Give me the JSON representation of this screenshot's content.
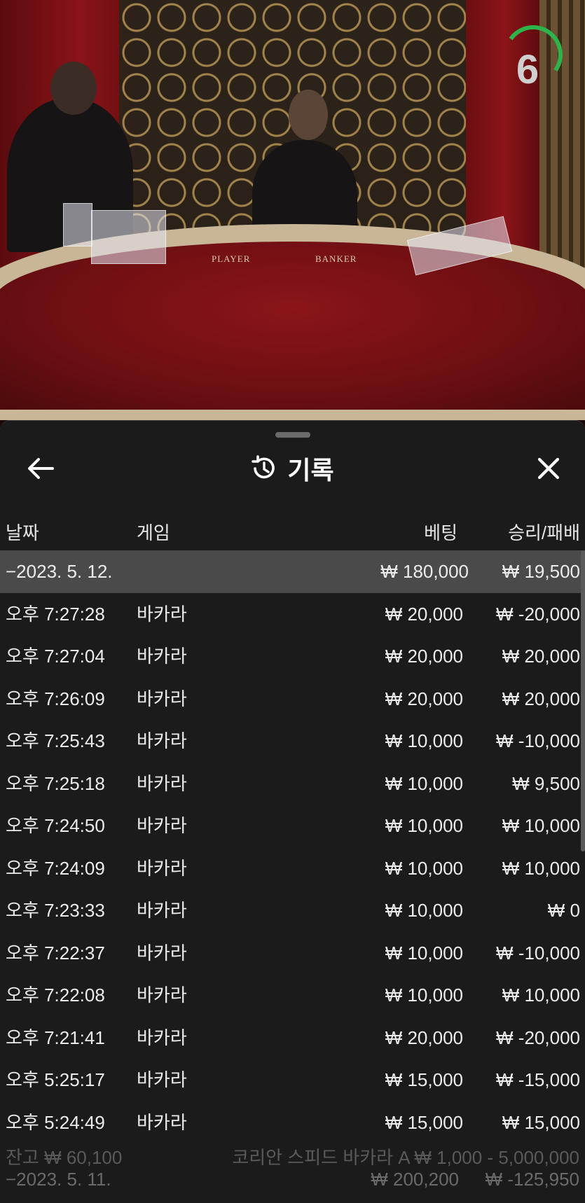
{
  "video": {
    "felt_player_label": "PLAYER",
    "felt_banker_label": "BANKER",
    "timer_value": "6",
    "timer_color": "#2db34a"
  },
  "history": {
    "title": "기록",
    "icons": {
      "back": "arrow-left-icon",
      "history": "history-clock-icon",
      "close": "close-icon"
    },
    "columns": {
      "date": "날짜",
      "game": "게임",
      "bet": "베팅",
      "win_loss": "승리/패배"
    },
    "summary_row": {
      "date": "−2023. 5. 12.",
      "bet": "₩ 180,000",
      "win_loss": "₩ 19,500"
    },
    "rows": [
      {
        "time": "오후 7:27:28",
        "game": "바카라",
        "bet": "₩ 20,000",
        "win_loss": "₩ -20,000"
      },
      {
        "time": "오후 7:27:04",
        "game": "바카라",
        "bet": "₩ 20,000",
        "win_loss": "₩ 20,000"
      },
      {
        "time": "오후 7:26:09",
        "game": "바카라",
        "bet": "₩ 20,000",
        "win_loss": "₩ 20,000"
      },
      {
        "time": "오후 7:25:43",
        "game": "바카라",
        "bet": "₩ 10,000",
        "win_loss": "₩ -10,000"
      },
      {
        "time": "오후 7:25:18",
        "game": "바카라",
        "bet": "₩ 10,000",
        "win_loss": "₩ 9,500"
      },
      {
        "time": "오후 7:24:50",
        "game": "바카라",
        "bet": "₩ 10,000",
        "win_loss": "₩ 10,000"
      },
      {
        "time": "오후 7:24:09",
        "game": "바카라",
        "bet": "₩ 10,000",
        "win_loss": "₩ 10,000"
      },
      {
        "time": "오후 7:23:33",
        "game": "바카라",
        "bet": "₩ 10,000",
        "win_loss": "₩ 0"
      },
      {
        "time": "오후 7:22:37",
        "game": "바카라",
        "bet": "₩ 10,000",
        "win_loss": "₩ -10,000"
      },
      {
        "time": "오후 7:22:08",
        "game": "바카라",
        "bet": "₩ 10,000",
        "win_loss": "₩ 10,000"
      },
      {
        "time": "오후 7:21:41",
        "game": "바카라",
        "bet": "₩ 20,000",
        "win_loss": "₩ -20,000"
      },
      {
        "time": "오후 5:25:17",
        "game": "바카라",
        "bet": "₩ 15,000",
        "win_loss": "₩ -15,000"
      },
      {
        "time": "오후 5:24:49",
        "game": "바카라",
        "bet": "₩ 15,000",
        "win_loss": "₩ 15,000"
      }
    ],
    "next_summary_row": {
      "date": "−2023. 5. 11.",
      "bet": "₩ 200,200",
      "win_loss": "₩ -125,950"
    },
    "background_footer": {
      "balance": "잔고 ₩ 60,100",
      "table_info": "코리안 스피드 바카라 A  ₩ 1,000 - 5,000,000"
    }
  }
}
